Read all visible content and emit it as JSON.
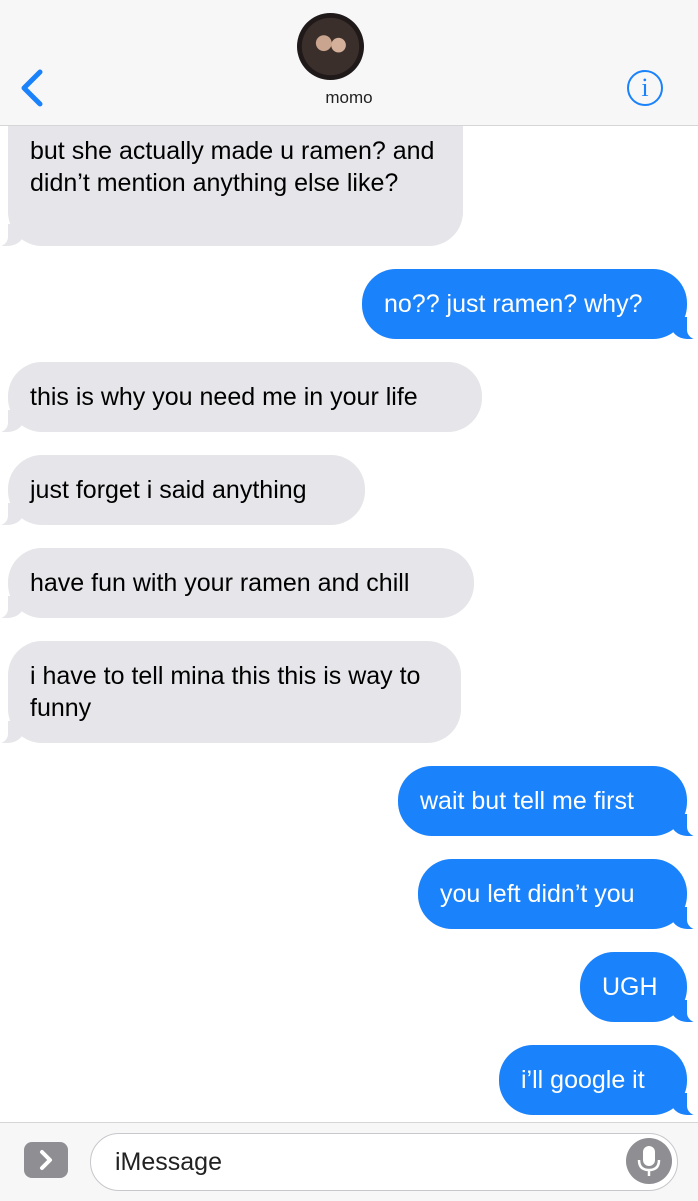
{
  "header": {
    "contact_name": "momo",
    "info_label": "i"
  },
  "messages": [
    {
      "direction": "incoming",
      "text": "but she actually made u ramen? and didn’t mention anything else like?"
    },
    {
      "direction": "outgoing",
      "text": "no?? just ramen? why?"
    },
    {
      "direction": "incoming",
      "text": "this is why you need me in your life"
    },
    {
      "direction": "incoming",
      "text": "just forget i said anything"
    },
    {
      "direction": "incoming",
      "text": "have fun with your ramen and chill"
    },
    {
      "direction": "incoming",
      "text": "i have to tell mina this this is way to funny"
    },
    {
      "direction": "outgoing",
      "text": "wait but tell me first"
    },
    {
      "direction": "outgoing",
      "text": "you left didn’t you"
    },
    {
      "direction": "outgoing",
      "text": "UGH"
    },
    {
      "direction": "outgoing",
      "text": "i’ll google it"
    }
  ],
  "input_bar": {
    "placeholder": "iMessage"
  },
  "colors": {
    "incoming_bubble": "#e5e5ea",
    "outgoing_bubble": "#1a82fb",
    "accent": "#1a82fb"
  },
  "icons": [
    "back-chevron-icon",
    "info-icon",
    "apps-chevron-icon",
    "microphone-icon"
  ]
}
